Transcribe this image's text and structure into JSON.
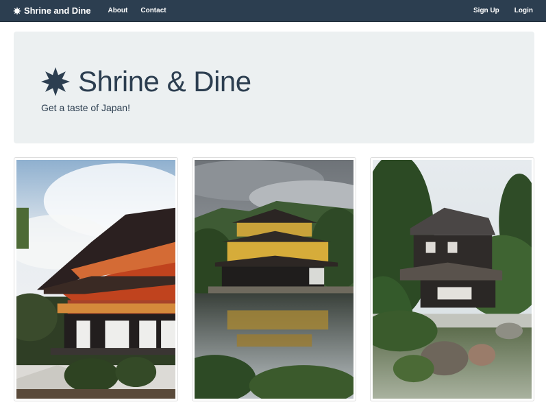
{
  "navbar": {
    "brand": "Shrine and Dine",
    "brand_icon": "starburst-icon",
    "links_left": [
      "About",
      "Contact"
    ],
    "links_right": [
      "Sign Up",
      "Login"
    ]
  },
  "hero": {
    "title": "Shrine & Dine",
    "subtitle": "Get a taste of Japan!",
    "icon": "starburst-icon"
  },
  "colors": {
    "navbar_bg": "#2c3e50",
    "hero_bg": "#ecf0f1",
    "text_primary": "#2c3e50"
  },
  "gallery": {
    "images": [
      {
        "subject": "red-pagoda-photo"
      },
      {
        "subject": "golden-pavilion-photo"
      },
      {
        "subject": "silver-pavilion-photo"
      }
    ]
  }
}
